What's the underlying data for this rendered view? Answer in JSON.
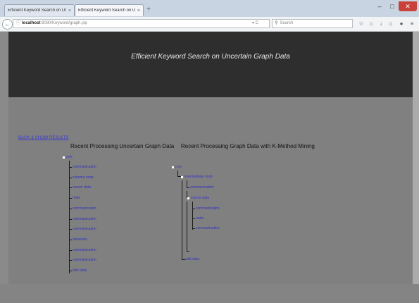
{
  "browser": {
    "tabs": [
      {
        "title": "Efficient Keyword Search on Un",
        "close": "×"
      },
      {
        "title": "Efficient Keyword Search on Un",
        "close": "×"
      }
    ],
    "new_tab": "+",
    "window_controls": {
      "minimize": "–",
      "maximize": "□",
      "close": "✕"
    },
    "back_glyph": "←",
    "address": {
      "host": "localhost",
      "path": ":8080/Keyword/graph.jsp"
    },
    "address_controls": "▾ C",
    "search_placeholder": "Search",
    "toolbar_icons": [
      "star-icon",
      "bookmarks-icon",
      "download-icon",
      "home-icon",
      "shield-icon",
      "menu-icon"
    ],
    "toolbar_glyphs": [
      "☆",
      "⌂",
      "↓",
      "⌂",
      "●",
      "≡"
    ]
  },
  "page": {
    "title": "Efficient Keyword Search on Uncertain Graph Data",
    "top_link": "BACK & SHOW RESULTS",
    "left_section": {
      "heading": "Recent Processing Uncertain Graph Data",
      "root": "root",
      "items": [
        "communication",
        "schema node",
        "sensor data",
        "node",
        "communication",
        "communication",
        "communication",
        "datanode",
        "communication",
        "communication",
        "sink data"
      ]
    },
    "right_section": {
      "heading": "Recent Processing Graph Data with K-Method Mining",
      "root": "root",
      "level1": "intermediate node",
      "level2a": "communication",
      "level2b": "source data",
      "level3": [
        "communication",
        "node",
        "communication"
      ],
      "tail": "sink data"
    }
  },
  "colors": {
    "header_bg": "#2e2e2e",
    "content_bg": "#808080",
    "link": "#3535c8",
    "close_btn": "#c9423a"
  }
}
